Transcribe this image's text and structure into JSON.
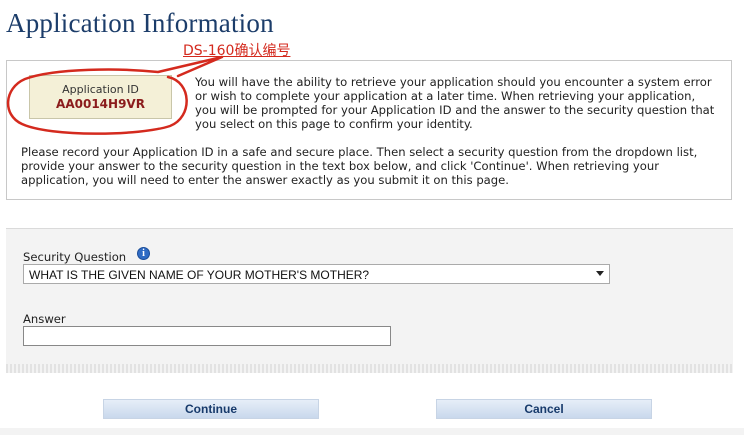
{
  "page": {
    "title": "Application Information"
  },
  "annotation": {
    "text": "DS-160确认编号"
  },
  "application_id": {
    "label": "Application ID",
    "value": "AA0014H9VR"
  },
  "intro": {
    "text": "You will have the ability to retrieve your application should you encounter a system error or wish to complete your application at a later time. When retrieving your application, you will be prompted for your Application ID and the answer to the security question that you select on this page to confirm your identity."
  },
  "record_note": {
    "text": "Please record your Application ID in a safe and secure place. Then select a security question from the dropdown list, provide your answer to the security question in the text box below, and click 'Continue'. When retrieving your application, you will need to enter the answer exactly as you submit it on this page."
  },
  "security": {
    "label": "Security Question",
    "info_icon": "info-icon",
    "selected": "WHAT IS THE GIVEN NAME OF YOUR MOTHER'S MOTHER?"
  },
  "answer": {
    "label": "Answer",
    "value": ""
  },
  "buttons": {
    "continue_label": "Continue",
    "cancel_label": "Cancel"
  },
  "colors": {
    "title": "#1c3d6a",
    "annotation": "#d42a1e",
    "app_id_value": "#8b1c1c",
    "button_text": "#173a6b",
    "info_icon": "#2f6bc4"
  }
}
